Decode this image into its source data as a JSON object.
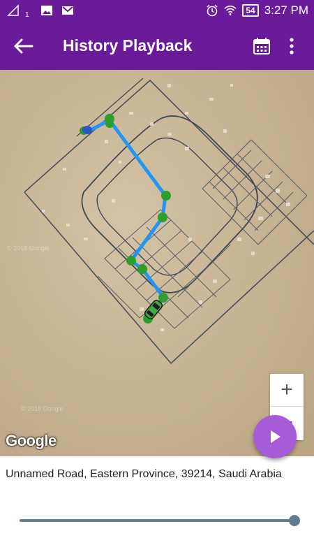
{
  "status_bar": {
    "sim_number": "1",
    "battery": "54",
    "time": "3:27 PM"
  },
  "app_bar": {
    "title": "History Playback",
    "icons": [
      "back-arrow-icon",
      "calendar-icon",
      "more-vert-icon"
    ]
  },
  "map": {
    "attribution": "Google",
    "watermarks": [
      "© 2018 Google",
      "© 2018 Google"
    ],
    "zoom_in": "+",
    "zoom_out": "−"
  },
  "playback": {
    "address": "Unnamed Road, Eastern Province, 39214, Saudi Arabia",
    "progress": 1.0
  },
  "colors": {
    "app_bar": "#6a1b9a",
    "fab": "#a55cd6",
    "route": "#2196f3",
    "stop_marker": "#2e9e2e",
    "slider": "#5f7d8f"
  }
}
